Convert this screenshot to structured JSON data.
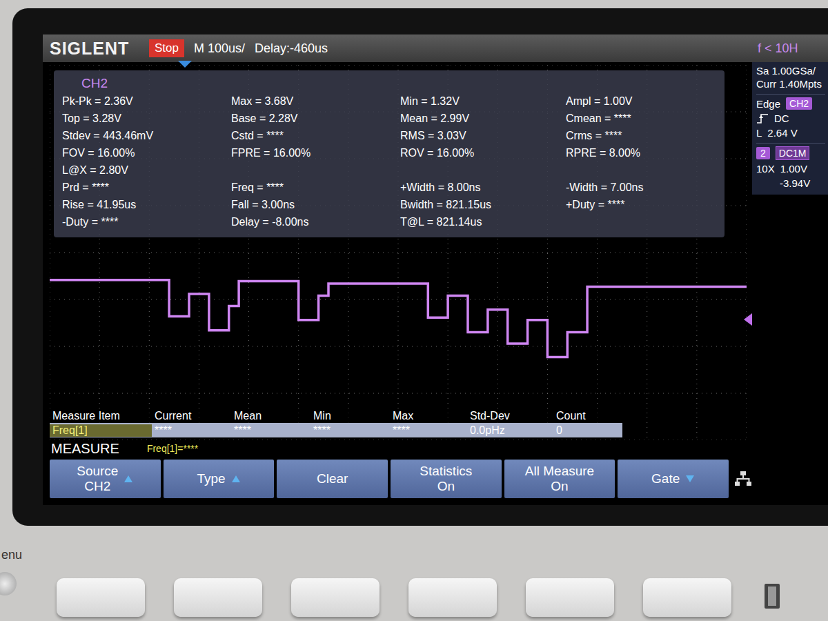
{
  "toolbar": {
    "brand": "SIGLENT",
    "run_state": "Stop",
    "timebase": "M 100us/",
    "delay": "Delay:-460us",
    "trigger_filter": "f < 10H"
  },
  "measurements": {
    "channel": "CH2",
    "rows": [
      [
        "Pk-Pk = 2.36V",
        "Max = 3.68V",
        "Min = 1.32V",
        "Ampl = 1.00V"
      ],
      [
        "Top = 3.28V",
        "Base = 2.28V",
        "Mean = 2.99V",
        "Cmean = ****"
      ],
      [
        "Stdev = 443.46mV",
        "Cstd = ****",
        "RMS = 3.03V",
        "Crms = ****"
      ],
      [
        "FOV = 16.00%",
        "FPRE = 16.00%",
        "ROV = 16.00%",
        "RPRE = 8.00%"
      ],
      [
        "L@X = 2.80V",
        "",
        "",
        ""
      ],
      [
        "Prd = ****",
        "Freq = ****",
        "+Width = 8.00ns",
        "-Width = 7.00ns"
      ],
      [
        "Rise = 41.95us",
        "Fall = 3.00ns",
        "Bwidth = 821.15us",
        "+Duty = ****"
      ],
      [
        "-Duty = ****",
        "Delay = -8.00ns",
        "T@L = 821.14us",
        ""
      ]
    ]
  },
  "side_panel": {
    "sample_rate": "Sa 1.00GSa/",
    "memory": "Curr 1.40Mpts",
    "trigger": {
      "type": "Edge",
      "source": "CH2",
      "coupling": "DC",
      "level_label": "L",
      "level": "2.64 V"
    },
    "channel": {
      "number": "2",
      "coupling": "DC1M",
      "probe": "10X",
      "scale": "1.00V",
      "offset": "-3.94V"
    }
  },
  "waveform": {
    "channel": "CH2",
    "values": [
      3.28,
      3.28,
      3.28,
      3.28,
      3.28,
      3.28,
      3.28,
      3.28,
      3.28,
      3.28,
      3.28,
      3.28,
      2.68,
      2.68,
      3.05,
      3.05,
      2.45,
      2.45,
      2.85,
      3.26,
      3.26,
      3.26,
      3.26,
      3.26,
      3.26,
      2.62,
      2.62,
      3.02,
      3.22,
      3.22,
      3.22,
      3.22,
      3.22,
      3.22,
      3.22,
      3.22,
      3.22,
      3.22,
      2.66,
      2.66,
      3.02,
      3.02,
      2.42,
      2.42,
      2.79,
      2.79,
      2.23,
      2.23,
      2.62,
      2.62,
      2.01,
      2.01,
      2.42,
      2.42,
      3.17,
      3.17,
      3.17,
      3.17,
      3.17,
      3.17,
      3.17,
      3.17,
      3.17,
      3.17,
      3.17,
      3.17,
      3.17,
      3.17,
      3.17,
      3.17
    ]
  },
  "statistics": {
    "columns": [
      "Measure Item",
      "Current",
      "Mean",
      "Min",
      "Max",
      "Std-Dev",
      "Count"
    ],
    "rows": [
      {
        "cells": [
          "Freq[1]",
          "****",
          "****",
          "****",
          "****",
          "0.0pHz",
          "0"
        ],
        "selected": true
      }
    ]
  },
  "measure_bar": {
    "title": "MEASURE",
    "readout": "Freq[1]=****"
  },
  "softkeys": [
    {
      "lines": [
        "Source",
        "CH2"
      ],
      "kind": "up"
    },
    {
      "lines": [
        "Type"
      ],
      "kind": "up"
    },
    {
      "lines": [
        "Clear"
      ],
      "kind": "plain"
    },
    {
      "lines": [
        "Statistics",
        "On"
      ],
      "kind": "plain"
    },
    {
      "lines": [
        "All Measure",
        "On"
      ],
      "kind": "plain"
    },
    {
      "lines": [
        "Gate"
      ],
      "kind": "down"
    }
  ],
  "front_panel": {
    "menu_label": "enu"
  }
}
